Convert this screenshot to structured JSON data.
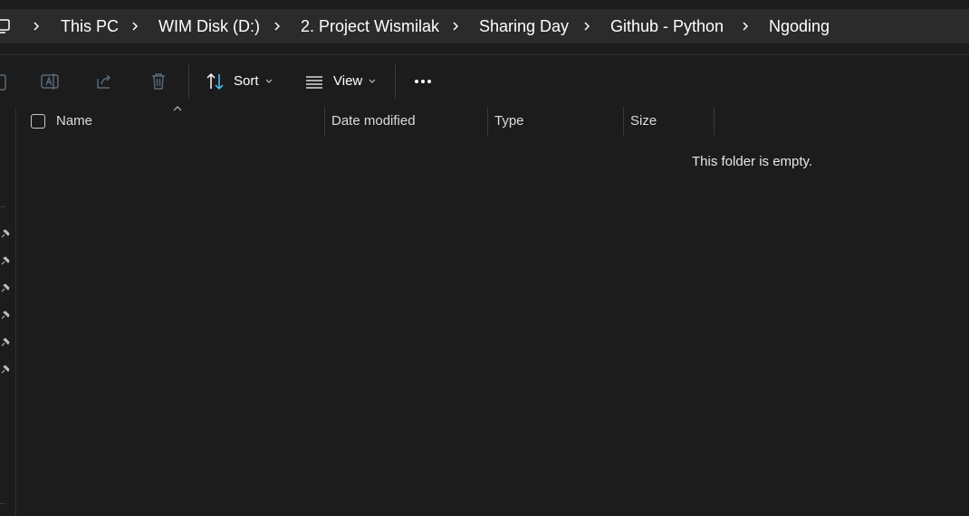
{
  "breadcrumb": {
    "items": [
      {
        "label": "This PC"
      },
      {
        "label": "WIM Disk (D:)"
      },
      {
        "label": "2. Project Wismilak"
      },
      {
        "label": "Sharing Day"
      },
      {
        "label": "Github - Python"
      },
      {
        "label": "Ngoding"
      }
    ]
  },
  "toolbar": {
    "icons": [
      "paste-icon",
      "rename-icon",
      "share-icon",
      "delete-icon"
    ],
    "sort_label": "Sort",
    "view_label": "View",
    "more_icon": "more-icon"
  },
  "columns": {
    "name": "Name",
    "date_modified": "Date modified",
    "type": "Type",
    "size": "Size"
  },
  "content": {
    "empty_message": "This folder is empty."
  },
  "colors": {
    "background": "#1c1c1c",
    "address_bar": "#2b2b2b",
    "text": "#ffffff"
  }
}
